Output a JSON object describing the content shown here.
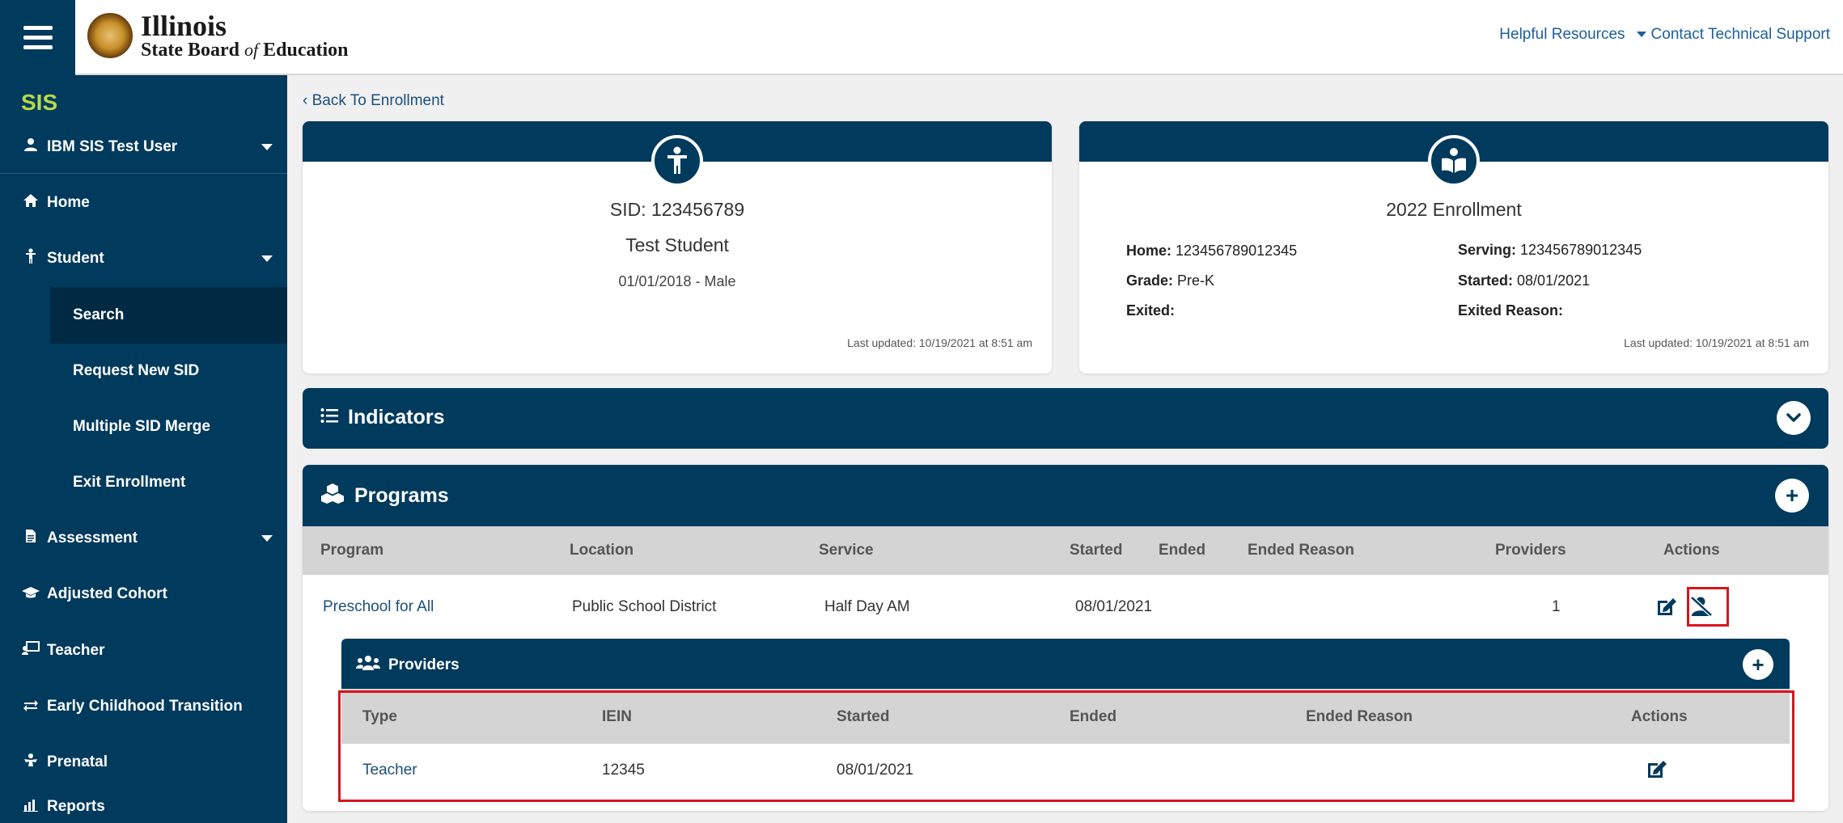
{
  "header": {
    "logo_line1": "Illinois",
    "logo_line2_bold": "State Board",
    "logo_line2_of": "of",
    "logo_line2_end": "Education",
    "helpful_resources": "Helpful Resources",
    "contact_support": "Contact Technical Support"
  },
  "sidebar": {
    "app": "SIS",
    "user": "IBM SIS Test User",
    "items": [
      {
        "label": "Home"
      },
      {
        "label": "Student"
      },
      {
        "label": "Search"
      },
      {
        "label": "Request New SID"
      },
      {
        "label": "Multiple SID Merge"
      },
      {
        "label": "Exit Enrollment"
      },
      {
        "label": "Assessment"
      },
      {
        "label": "Adjusted Cohort"
      },
      {
        "label": "Teacher"
      },
      {
        "label": "Early Childhood Transition"
      },
      {
        "label": "Prenatal"
      },
      {
        "label": "Reports"
      }
    ]
  },
  "main": {
    "back_link": "Back To Enrollment",
    "student_card": {
      "sid": "SID: 123456789",
      "name": "Test Student",
      "dob_gender": "01/01/2018 - Male",
      "updated": "Last updated: 10/19/2021 at 8:51 am"
    },
    "enrollment_card": {
      "title": "2022 Enrollment",
      "home_label": "Home:",
      "home_value": "123456789012345",
      "grade_label": "Grade:",
      "grade_value": "Pre-K",
      "exited_label": "Exited:",
      "exited_value": "",
      "serving_label": "Serving:",
      "serving_value": "123456789012345",
      "started_label": "Started:",
      "started_value": "08/01/2021",
      "exited_reason_label": "Exited Reason:",
      "exited_reason_value": "",
      "updated": "Last updated: 10/19/2021 at 8:51 am"
    },
    "indicators": {
      "title": "Indicators"
    },
    "programs": {
      "title": "Programs",
      "columns": [
        "Program",
        "Location",
        "Service",
        "Started",
        "Ended",
        "Ended Reason",
        "Providers",
        "Actions"
      ],
      "rows": [
        {
          "program": "Preschool for All",
          "location": "Public School District",
          "service": "Half Day AM",
          "started": "08/01/2021",
          "ended": "",
          "ended_reason": "",
          "providers": "1"
        }
      ]
    },
    "providers": {
      "title": "Providers",
      "columns": [
        "Type",
        "IEIN",
        "Started",
        "Ended",
        "Ended Reason",
        "Actions"
      ],
      "rows": [
        {
          "type": "Teacher",
          "iein": "12345",
          "started": "08/01/2021",
          "ended": "",
          "ended_reason": ""
        }
      ]
    }
  },
  "colors": {
    "navy": "#003a5d",
    "accent_green": "#b8d94a",
    "highlight_red": "#d9141b",
    "link": "#1d4f7c"
  }
}
